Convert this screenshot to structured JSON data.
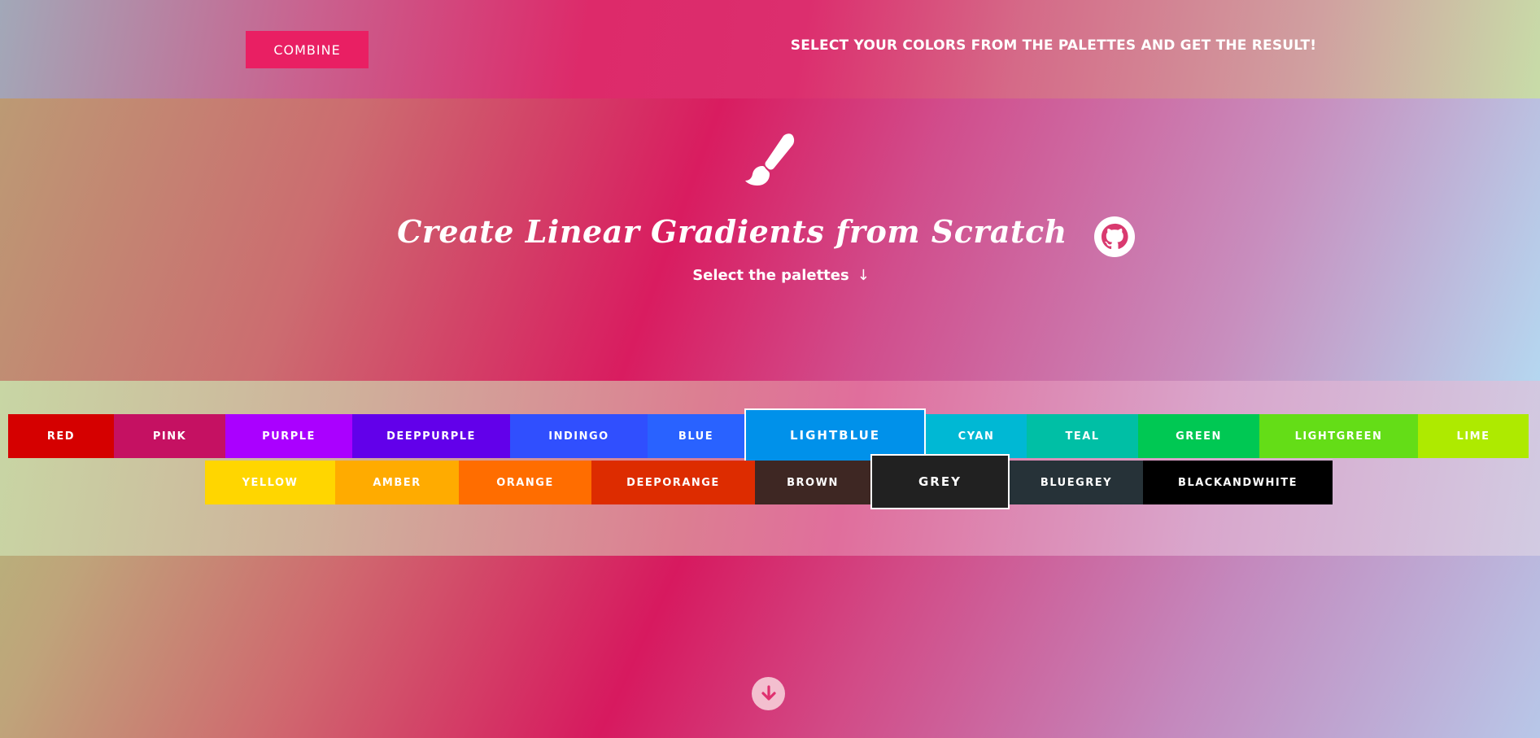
{
  "header": {
    "combine_label": "COMBINE",
    "tagline": "SELECT YOUR COLORS FROM THE PALETTES AND GET THE RESULT!"
  },
  "hero": {
    "icon": "paintbrush-icon",
    "title": "Create Linear Gradients from Scratch",
    "github_icon": "github-icon",
    "subtitle": "Select the palettes",
    "subtitle_arrow": "↓"
  },
  "palettes": {
    "row1": [
      {
        "label": "RED",
        "color": "#d50000"
      },
      {
        "label": "PINK",
        "color": "#c51162"
      },
      {
        "label": "PURPLE",
        "color": "#aa00ff"
      },
      {
        "label": "DEEPPURPLE",
        "color": "#6200ea"
      },
      {
        "label": "INDINGO",
        "color": "#304ffe"
      },
      {
        "label": "BLUE",
        "color": "#2962ff"
      },
      {
        "label": "LIGHTBLUE",
        "color": "#0091ea",
        "selected": true
      },
      {
        "label": "CYAN",
        "color": "#00b8d4"
      },
      {
        "label": "TEAL",
        "color": "#00bfa5"
      },
      {
        "label": "GREEN",
        "color": "#00c853"
      },
      {
        "label": "LIGHTGREEN",
        "color": "#64dd17"
      },
      {
        "label": "LIME",
        "color": "#aeea00"
      }
    ],
    "row2": [
      {
        "label": "YELLOW",
        "color": "#ffd600"
      },
      {
        "label": "AMBER",
        "color": "#ffab00"
      },
      {
        "label": "ORANGE",
        "color": "#ff6d00"
      },
      {
        "label": "DEEPORANGE",
        "color": "#dd2c00"
      },
      {
        "label": "BROWN",
        "color": "#3e2723"
      },
      {
        "label": "GREY",
        "color": "#212121",
        "selected": true
      },
      {
        "label": "BLUEGREY",
        "color": "#263238"
      },
      {
        "label": "BLACKANDWHITE",
        "color": "#000000"
      }
    ]
  },
  "footer": {
    "scroll_icon": "arrow-down-circle-icon"
  }
}
